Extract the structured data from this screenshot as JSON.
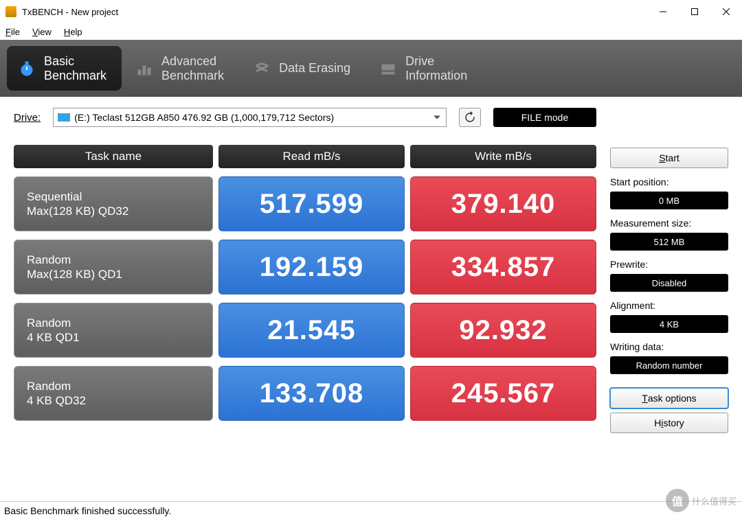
{
  "window": {
    "title": "TxBENCH - New project"
  },
  "menu": {
    "file": "File",
    "view": "View",
    "help": "Help"
  },
  "tabs": {
    "basic": "Basic\nBenchmark",
    "advanced": "Advanced\nBenchmark",
    "erasing": "Data Erasing",
    "drive": "Drive\nInformation"
  },
  "drive": {
    "label": "Drive:",
    "selected": "(E:) Teclast 512GB A850   476.92 GB (1,000,179,712 Sectors)",
    "filemode": "FILE mode"
  },
  "headers": {
    "task": "Task name",
    "read": "Read mB/s",
    "write": "Write mB/s"
  },
  "rows": [
    {
      "name1": "Sequential",
      "name2": "Max(128 KB) QD32",
      "read": "517.599",
      "write": "379.140"
    },
    {
      "name1": "Random",
      "name2": "Max(128 KB) QD1",
      "read": "192.159",
      "write": "334.857"
    },
    {
      "name1": "Random",
      "name2": "4 KB QD1",
      "read": "21.545",
      "write": "92.932"
    },
    {
      "name1": "Random",
      "name2": "4 KB QD32",
      "read": "133.708",
      "write": "245.567"
    }
  ],
  "sidebar": {
    "start": "Start",
    "start_pos_label": "Start position:",
    "start_pos_value": "0 MB",
    "measure_label": "Measurement size:",
    "measure_value": "512 MB",
    "prewrite_label": "Prewrite:",
    "prewrite_value": "Disabled",
    "align_label": "Alignment:",
    "align_value": "4 KB",
    "writing_label": "Writing data:",
    "writing_value": "Random number",
    "taskopt": "Task options",
    "history": "History"
  },
  "status": "Basic Benchmark finished successfully.",
  "watermark": {
    "badge": "值",
    "text": "什么值得买"
  }
}
